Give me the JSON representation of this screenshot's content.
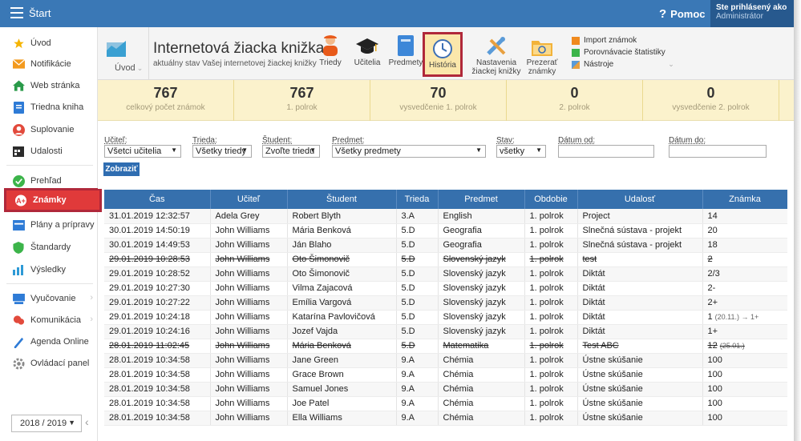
{
  "topbar": {
    "title": "Štart",
    "help": "Pomoc",
    "user_line1": "Ste prihlásený ako",
    "user_line2": "Administrátor"
  },
  "sidebar": {
    "items": [
      {
        "label": "Úvod",
        "icon": "star-icon"
      },
      {
        "label": "Notifikácie",
        "icon": "envelope-icon"
      },
      {
        "label": "Web stránka",
        "icon": "home-icon"
      },
      {
        "label": "Triedna kniha",
        "icon": "book-icon"
      },
      {
        "label": "Suplovanie",
        "icon": "person-icon"
      },
      {
        "label": "Udalosti",
        "icon": "calendar-icon"
      },
      {
        "label": "Prehľad",
        "icon": "check-circle-icon"
      },
      {
        "label": "Známky",
        "icon": "grade-icon"
      },
      {
        "label": "Plány a prípravy",
        "icon": "plan-icon"
      },
      {
        "label": "Štandardy",
        "icon": "shield-icon"
      },
      {
        "label": "Výsledky",
        "icon": "bar-chart-icon"
      },
      {
        "label": "Vyučovanie",
        "icon": "board-icon"
      },
      {
        "label": "Komunikácia",
        "icon": "chat-icon"
      },
      {
        "label": "Agenda Online",
        "icon": "pen-icon"
      },
      {
        "label": "Ovládací panel",
        "icon": "gear-icon"
      }
    ],
    "year": "2018 / 2019"
  },
  "toolbar": {
    "crumb": "Úvod",
    "title": "Internetová žiacka knižka",
    "subtitle": "aktuálny stav Vašej internetovej žiackej knižky",
    "tools": [
      {
        "label": "Triedy"
      },
      {
        "label": "Učitelia"
      },
      {
        "label": "Predmety"
      },
      {
        "label": "História"
      },
      {
        "label": "Nastavenia",
        "label2": "žiackej knižky"
      },
      {
        "label": "Prezerať",
        "label2": "známky"
      }
    ],
    "links": [
      "Import známok",
      "Porovnávacie štatistiky",
      "Nástroje"
    ]
  },
  "stats": [
    {
      "value": "767",
      "caption": "celkový počet známok"
    },
    {
      "value": "767",
      "caption": "1. polrok"
    },
    {
      "value": "70",
      "caption": "vysvedčenie 1. polrok"
    },
    {
      "value": "0",
      "caption": "2. polrok"
    },
    {
      "value": "0",
      "caption": "vysvedčenie 2. polrok"
    }
  ],
  "filters": {
    "teacher_label": "Učiteľ:",
    "teacher_value": "Všetci učitelia",
    "class_label": "Trieda:",
    "class_value": "Všetky triedy",
    "student_label": "Študent:",
    "student_value": "Zvoľte triedu",
    "subject_label": "Predmet:",
    "subject_value": "Všetky predmety",
    "state_label": "Stav:",
    "state_value": "všetky",
    "date_from_label": "Dátum od:",
    "date_to_label": "Dátum do:",
    "show_button": "Zobraziť"
  },
  "table": {
    "headers": [
      "Čas",
      "Učiteľ",
      "Študent",
      "Trieda",
      "Predmet",
      "Obdobie",
      "Udalosť",
      "Známka"
    ],
    "rows": [
      {
        "time": "31.01.2019 12:32:57",
        "teacher": "Adela Grey",
        "student": "Robert Blyth",
        "class": "3.A",
        "subject": "English",
        "period": "1. polrok",
        "event": "Project",
        "grade": "14",
        "grade_note": "",
        "struck": false
      },
      {
        "time": "30.01.2019 14:50:19",
        "teacher": "John Williams",
        "student": "Mária Benková",
        "class": "5.D",
        "subject": "Geografia",
        "period": "1. polrok",
        "event": "Slnečná sústava - projekt",
        "grade": "20",
        "grade_note": "",
        "struck": false
      },
      {
        "time": "30.01.2019 14:49:53",
        "teacher": "John Williams",
        "student": "Ján Blaho",
        "class": "5.D",
        "subject": "Geografia",
        "period": "1. polrok",
        "event": "Slnečná sústava - projekt",
        "grade": "18",
        "grade_note": "",
        "struck": false
      },
      {
        "time": "29.01.2019 10:28:53",
        "teacher": "John Williams",
        "student": "Oto Šimonovič",
        "class": "5.D",
        "subject": "Slovenský jazyk",
        "period": "1. polrok",
        "event": "test",
        "grade": "2",
        "grade_note": "",
        "struck": true
      },
      {
        "time": "29.01.2019 10:28:52",
        "teacher": "John Williams",
        "student": "Oto Šimonovič",
        "class": "5.D",
        "subject": "Slovenský jazyk",
        "period": "1. polrok",
        "event": "Diktát",
        "grade": "2/3",
        "grade_note": "",
        "struck": false
      },
      {
        "time": "29.01.2019 10:27:30",
        "teacher": "John Williams",
        "student": "Vilma Zajacová",
        "class": "5.D",
        "subject": "Slovenský jazyk",
        "period": "1. polrok",
        "event": "Diktát",
        "grade": "2-",
        "grade_note": "",
        "struck": false
      },
      {
        "time": "29.01.2019 10:27:22",
        "teacher": "John Williams",
        "student": "Emília Vargová",
        "class": "5.D",
        "subject": "Slovenský jazyk",
        "period": "1. polrok",
        "event": "Diktát",
        "grade": "2+",
        "grade_note": "",
        "struck": false
      },
      {
        "time": "29.01.2019 10:24:18",
        "teacher": "John Williams",
        "student": "Katarína Pavlovičová",
        "class": "5.D",
        "subject": "Slovenský jazyk",
        "period": "1. polrok",
        "event": "Diktát",
        "grade": "1",
        "grade_note": "(20.11.) → 1+",
        "struck": false
      },
      {
        "time": "29.01.2019 10:24:16",
        "teacher": "John Williams",
        "student": "Jozef Vajda",
        "class": "5.D",
        "subject": "Slovenský jazyk",
        "period": "1. polrok",
        "event": "Diktát",
        "grade": "1+",
        "grade_note": "",
        "struck": false
      },
      {
        "time": "28.01.2019 11:02:45",
        "teacher": "John Williams",
        "student": "Mária Benková",
        "class": "5.D",
        "subject": "Matematika",
        "period": "1. polrok",
        "event": "Test ABC",
        "grade": "12",
        "grade_note": "(25.01.)",
        "struck": true
      },
      {
        "time": "28.01.2019 10:34:58",
        "teacher": "John Williams",
        "student": "Jane Green",
        "class": "9.A",
        "subject": "Chémia",
        "period": "1. polrok",
        "event": "Ústne skúšanie",
        "grade": "100",
        "grade_note": "",
        "struck": false
      },
      {
        "time": "28.01.2019 10:34:58",
        "teacher": "John Williams",
        "student": "Grace Brown",
        "class": "9.A",
        "subject": "Chémia",
        "period": "1. polrok",
        "event": "Ústne skúšanie",
        "grade": "100",
        "grade_note": "",
        "struck": false
      },
      {
        "time": "28.01.2019 10:34:58",
        "teacher": "John Williams",
        "student": "Samuel Jones",
        "class": "9.A",
        "subject": "Chémia",
        "period": "1. polrok",
        "event": "Ústne skúšanie",
        "grade": "100",
        "grade_note": "",
        "struck": false
      },
      {
        "time": "28.01.2019 10:34:58",
        "teacher": "John Williams",
        "student": "Joe Patel",
        "class": "9.A",
        "subject": "Chémia",
        "period": "1. polrok",
        "event": "Ústne skúšanie",
        "grade": "100",
        "grade_note": "",
        "struck": false
      },
      {
        "time": "28.01.2019 10:34:58",
        "teacher": "John Williams",
        "student": "Ella Williams",
        "class": "9.A",
        "subject": "Chémia",
        "period": "1. polrok",
        "event": "Ústne skúšanie",
        "grade": "100",
        "grade_note": "",
        "struck": false
      }
    ]
  }
}
